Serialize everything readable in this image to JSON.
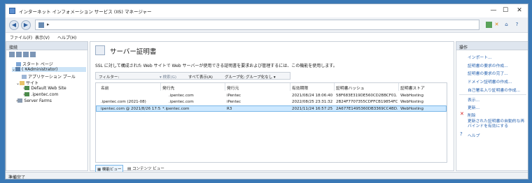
{
  "window": {
    "title": "インターネット インフォメーション サービス (IIS) マネージャー",
    "controls": {
      "minimize": "—",
      "maximize": "☐",
      "close": "✕"
    }
  },
  "address": {
    "arrow": "▸"
  },
  "menu": {
    "items": [
      "ファイル(F)",
      "表示(V)",
      "ヘルプ(H)"
    ]
  },
  "connections": {
    "header": "接続",
    "tree": [
      {
        "label": "スタート ページ",
        "icon": "start-page-icon"
      },
      {
        "label": "(              ¥Administrator)",
        "icon": "server-icon"
      },
      {
        "label": "アプリケーション プール",
        "icon": "app-pool-icon"
      },
      {
        "label": "サイト",
        "icon": "sites-folder-icon"
      },
      {
        "label": "Default Web Site",
        "icon": "website-icon"
      },
      {
        "label": ".ipentec.com",
        "icon": "website-icon"
      },
      {
        "label": "Server Farms",
        "icon": "server-farms-icon"
      }
    ]
  },
  "feature": {
    "title": "サーバー証明書",
    "description": "SSL に対して構成された Web サイトで Web サーバーが使用できる証明書を要求および管理するには、この機能を使用します。"
  },
  "filter": {
    "label": "フィルター:",
    "search": "検索(G)",
    "show_all": "すべて表示(A)",
    "group_label": "グループ化:",
    "group_value": "グループ化なし"
  },
  "table": {
    "columns": [
      "名前",
      "発行先",
      "発行元",
      "有効期限",
      "証明書ハッシュ",
      "証明書ストア"
    ],
    "rows": [
      {
        "name": "",
        "issued_to": ".ipentec.com",
        "issuer": "iPentec",
        "expires": "2021/08/24 18:06:40",
        "hash": "58F683E319DE560CD2BBCF01...",
        "store": "WebHosting",
        "selected": false
      },
      {
        "name": ".ipentec.com (2021-08)",
        "issued_to": ".ipentec.com",
        "issuer": "iPentec",
        "expires": "2022/08/25 23:31:32",
        "hash": "2B24F7707355CDFFCB19854FC...",
        "store": "WebHosting",
        "selected": false
      },
      {
        "name": "ipentec.com @ 2021/8/26 17:5...",
        "issued_to": "*.ipentec.com",
        "issuer": "R3",
        "expires": "2021/11/24 16:57:25",
        "hash": "2A677E1495360DB3369CC4BD...",
        "store": "WebHosting",
        "selected": true
      }
    ]
  },
  "bottom_tabs": [
    "機能ビュー",
    "コンテンツ ビュー"
  ],
  "actions": {
    "header": "操作",
    "items": [
      {
        "label": "インポート...",
        "enabled": true
      },
      {
        "label": "証明書の要求の作成...",
        "enabled": true
      },
      {
        "label": "証明書の要求の完了...",
        "enabled": true
      },
      {
        "label": "ドメイン証明書の作成...",
        "enabled": true
      },
      {
        "label": "自己署名入り証明書の作成...",
        "enabled": true
      },
      {
        "label": "表示...",
        "enabled": true
      },
      {
        "label": "更新...",
        "enabled": true
      },
      {
        "label": "削除",
        "enabled": true
      },
      {
        "label": "更新された証明書の自動的な再バインドを有効にする",
        "enabled": true
      },
      {
        "label": "ヘルプ",
        "enabled": true
      }
    ]
  },
  "status": {
    "text": "準備完了"
  },
  "colors": {
    "accent": "#2a64b0",
    "selection": "#cce8ff",
    "desktop": "#3a78b5"
  }
}
